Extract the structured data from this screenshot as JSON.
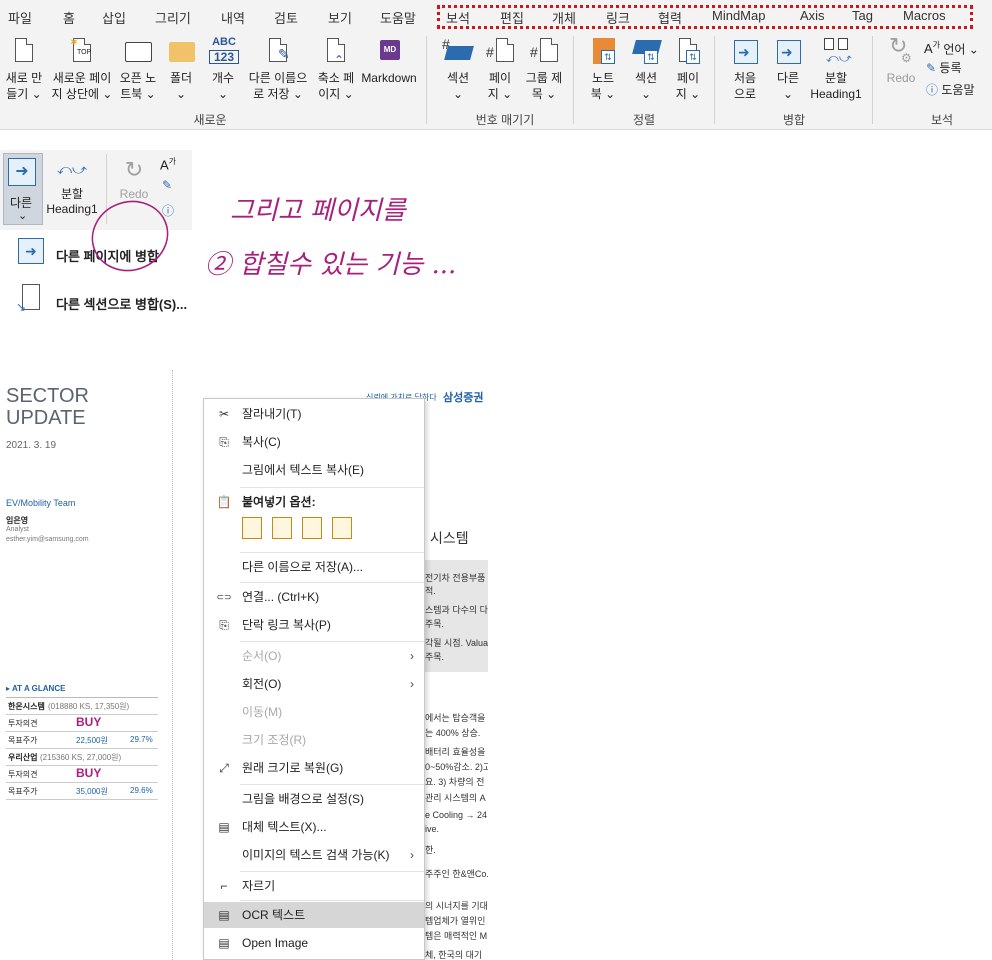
{
  "ribbon": {
    "tabs": [
      "파일",
      "홈",
      "삽입",
      "그리기",
      "내역",
      "검토",
      "보기",
      "도움말",
      "보석",
      "편집",
      "개체",
      "링크",
      "협력",
      "MindMap",
      "Axis",
      "Tag",
      "Macros"
    ],
    "groups": {
      "new": {
        "label": "새로운",
        "buttons": [
          {
            "l1": "새로 만",
            "l2": "들기 ⌄"
          },
          {
            "l1": "새로운 페이",
            "l2": "지 상단에 ⌄"
          },
          {
            "l1": "오픈 노",
            "l2": "트북 ⌄"
          },
          {
            "l1": "폴더",
            "l2": "⌄"
          },
          {
            "l1": "개수",
            "l2": "⌄"
          },
          {
            "l1": "다른 이름으",
            "l2": "로 저장 ⌄"
          },
          {
            "l1": "축소 페",
            "l2": "이지 ⌄"
          },
          {
            "l1": "Markdown",
            "l2": ""
          }
        ]
      },
      "numbering": {
        "label": "번호 매기기",
        "buttons": [
          {
            "l1": "섹션",
            "l2": "⌄"
          },
          {
            "l1": "페이",
            "l2": "지 ⌄"
          },
          {
            "l1": "그룹 제",
            "l2": "목 ⌄"
          }
        ]
      },
      "sort": {
        "label": "정렬",
        "buttons": [
          {
            "l1": "노트",
            "l2": "북 ⌄"
          },
          {
            "l1": "섹션",
            "l2": "⌄"
          },
          {
            "l1": "페이",
            "l2": "지 ⌄"
          }
        ]
      },
      "merge": {
        "label": "병합",
        "buttons": [
          {
            "l1": "처음",
            "l2": "으로"
          },
          {
            "l1": "다른",
            "l2": "⌄"
          },
          {
            "l1": "분할",
            "l2": "Heading1"
          }
        ]
      },
      "gem": {
        "label": "보석",
        "redo": "Redo",
        "items": [
          "언어 ⌄",
          "등록",
          "도움말"
        ]
      }
    }
  },
  "fragment": {
    "other_label": "다른",
    "other_arrow": "⌄",
    "split_label": "분할",
    "split_sub": "Heading1",
    "redo": "Redo",
    "menu": [
      "다른 페이지에 병합",
      "다른 섹션으로 병합(S)..."
    ]
  },
  "handwriting": {
    "line1": "그리고 페이지를",
    "line2": "② 합칠수 있는 기능 ..."
  },
  "document": {
    "title1": "SECTOR",
    "title2": "UPDATE",
    "date": "2021. 3. 19",
    "team": "EV/Mobility Team",
    "analyst_name": "임은영",
    "analyst_role": "Analyst",
    "analyst_email": "esther.yim@samsung.com",
    "brand_tag": "신뢰에 가치로 답하다",
    "brand": "삼성증권",
    "heading_fragment": "시스템",
    "glance_title": "AT A GLANCE",
    "glance": [
      {
        "name": "한온시스템",
        "code": "(018880 KS, 17,350원)"
      },
      {
        "label": "투자의견",
        "value": "BUY"
      },
      {
        "label": "목표주가",
        "price": "22,500원",
        "pct": "29.7%"
      },
      {
        "name": "우리산업",
        "code": "(215360 KS, 27,000원)"
      },
      {
        "label": "투자의견",
        "value": "BUY"
      },
      {
        "label": "목표주가",
        "price": "35,000원",
        "pct": "29.6%"
      }
    ],
    "tail_lines": [
      "전기차 전용부품",
      "적.",
      "스템과 다수의 다",
      "주목.",
      "각될 시점. Valuat",
      "주목.",
      "에서는 탑승객을 위",
      "는 400% 상승.",
      "배터리 효율성을 위",
      "0~50%감소. 2)고",
      "요. 3) 차량의 전",
      "관리 시스템의 A",
      "e Cooling → 24",
      "ive.",
      "한.",
      "주주인 한&앤Co.",
      "의 시너지를 기대",
      "템업체가 열위인",
      "템은 매력적인 M",
      "체, 한국의 대기"
    ]
  },
  "context_menu": {
    "items": [
      {
        "icon": "✂",
        "text": "잘라내기(T)"
      },
      {
        "icon": "⎘",
        "text": "복사(C)"
      },
      {
        "icon": "",
        "text": "그림에서 텍스트 복사(E)"
      },
      {
        "icon": "📋",
        "text": "붙여넣기 옵션:"
      },
      {
        "icon": "",
        "text": "다른 이름으로 저장(A)..."
      },
      {
        "icon": "⊂⊃",
        "text": "연결...  (Ctrl+K)"
      },
      {
        "icon": "⎘",
        "text": "단락 링크 복사(P)"
      },
      {
        "icon": "",
        "text": "순서(O)"
      },
      {
        "icon": "",
        "text": "회전(O)"
      },
      {
        "icon": "",
        "text": "이동(M)"
      },
      {
        "icon": "",
        "text": "크기 조정(R)"
      },
      {
        "icon": "⤢",
        "text": "원래 크기로 복원(G)"
      },
      {
        "icon": "",
        "text": "그림을 배경으로 설정(S)"
      },
      {
        "icon": "▤",
        "text": "대체 텍스트(X)..."
      },
      {
        "icon": "",
        "text": "이미지의 텍스트 검색 가능(K)"
      },
      {
        "icon": "⌐",
        "text": "자르기"
      },
      {
        "icon": "▤",
        "text": "OCR 텍스트"
      },
      {
        "icon": "▤",
        "text": "Open Image"
      }
    ],
    "submenu_arrow": "›"
  }
}
